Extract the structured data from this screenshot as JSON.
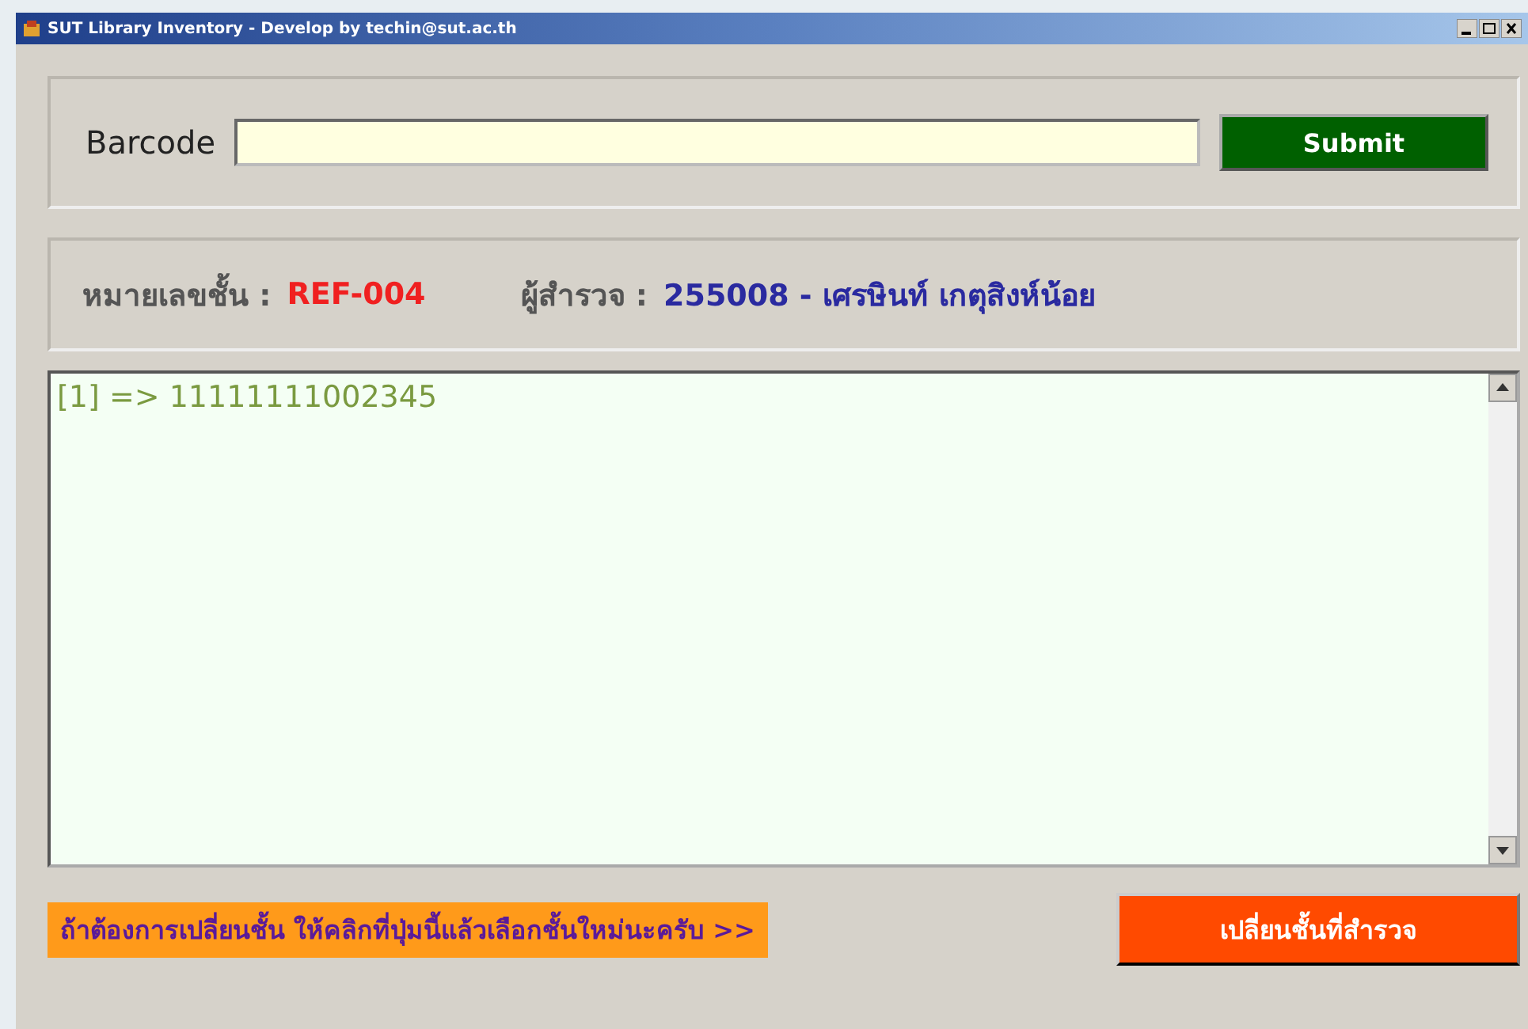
{
  "window": {
    "title": "SUT Library Inventory - Develop by techin@sut.ac.th"
  },
  "barcode": {
    "label": "Barcode",
    "submit": "Submit"
  },
  "info": {
    "shelf_label": "หมายเลขชั้น :",
    "shelf_value": "REF-004",
    "surveyor_label": "ผู้สำรวจ :",
    "surveyor_value": "255008 - เศรษินท์ เกตุสิงห์น้อย"
  },
  "log": [
    "[1] => 11111111002345"
  ],
  "footer": {
    "hint": "ถ้าต้องการเปลี่ยนชั้น ให้คลิกที่ปุ่มนี้แล้วเลือกชั้นใหม่นะครับ >>",
    "button": "เปลี่ยนชั้นที่สำรวจ"
  }
}
